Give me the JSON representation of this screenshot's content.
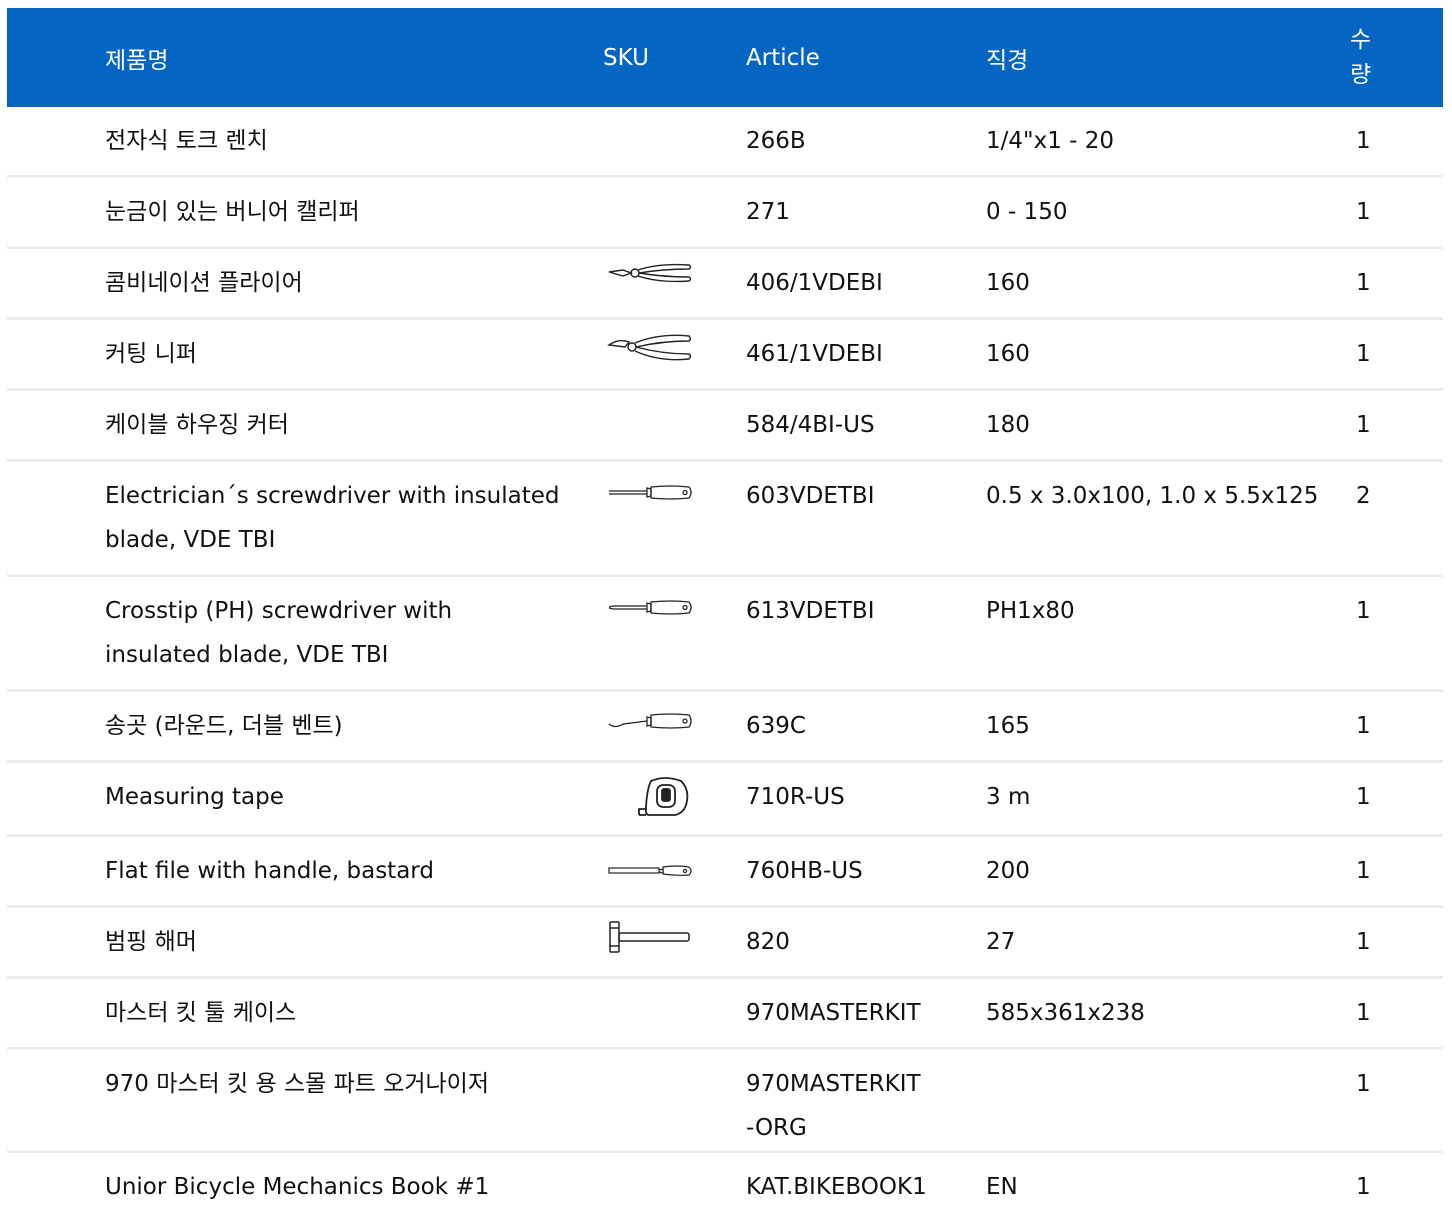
{
  "header": {
    "name": "제품명",
    "sku": "SKU",
    "article": "Article",
    "diameter": "직경",
    "quantity": "수량"
  },
  "rows": [
    {
      "name": "전자식 토크 렌치",
      "sku_icon": "",
      "article": "266B",
      "diameter": "1/4\"x1 - 20",
      "qty": "1"
    },
    {
      "name": "눈금이 있는 버니어 캘리퍼",
      "sku_icon": "",
      "article": "271",
      "diameter": "0 - 150",
      "qty": "1"
    },
    {
      "name": "콤비네이션 플라이어",
      "sku_icon": "pliers-icon",
      "article": "406/1VDEBI",
      "diameter": "160",
      "qty": "1"
    },
    {
      "name": "커팅 니퍼",
      "sku_icon": "cutting-nipper-icon",
      "article": "461/1VDEBI",
      "diameter": "160",
      "qty": "1"
    },
    {
      "name": "케이블 하우징 커터",
      "sku_icon": "",
      "article": "584/4BI-US",
      "diameter": "180",
      "qty": "1"
    },
    {
      "name": "Electrician´s screwdriver with insulated blade, VDE TBI",
      "sku_icon": "flat-screwdriver-icon",
      "article": "603VDETBI",
      "diameter": "0.5 x 3.0x100, 1.0 x 5.5x125",
      "qty": "2"
    },
    {
      "name": "Crosstip (PH) screwdriver with insulated blade, VDE TBI",
      "sku_icon": "phillips-screwdriver-icon",
      "article": "613VDETBI",
      "diameter": "PH1x80",
      "qty": "1"
    },
    {
      "name": "송곳 (라운드, 더블 벤트)",
      "sku_icon": "awl-icon",
      "article": "639C",
      "diameter": "165",
      "qty": "1"
    },
    {
      "name": "Measuring tape",
      "sku_icon": "measuring-tape-icon",
      "article": "710R-US",
      "diameter": "3 m",
      "qty": "1"
    },
    {
      "name": "Flat file with handle, bastard",
      "sku_icon": "flat-file-icon",
      "article": "760HB-US",
      "diameter": "200",
      "qty": "1"
    },
    {
      "name": "범핑 해머",
      "sku_icon": "hammer-icon",
      "article": "820",
      "diameter": "27",
      "qty": "1"
    },
    {
      "name": "마스터 킷 툴 케이스",
      "sku_icon": "",
      "article": "970MASTERKIT",
      "diameter": "585x361x238",
      "qty": "1"
    },
    {
      "name": "970 마스터 킷 용 스몰 파트 오거나이저",
      "sku_icon": "",
      "article": "970MASTERKIT-ORG",
      "diameter": "",
      "qty": "1"
    },
    {
      "name": "Unior Bicycle Mechanics Book #1",
      "sku_icon": "",
      "article": "KAT.BIKEBOOK1",
      "diameter": "EN",
      "qty": "1"
    }
  ],
  "colors": {
    "header_bg": "#0565c3",
    "header_text": "#ffffff",
    "row_border": "#ececec"
  }
}
